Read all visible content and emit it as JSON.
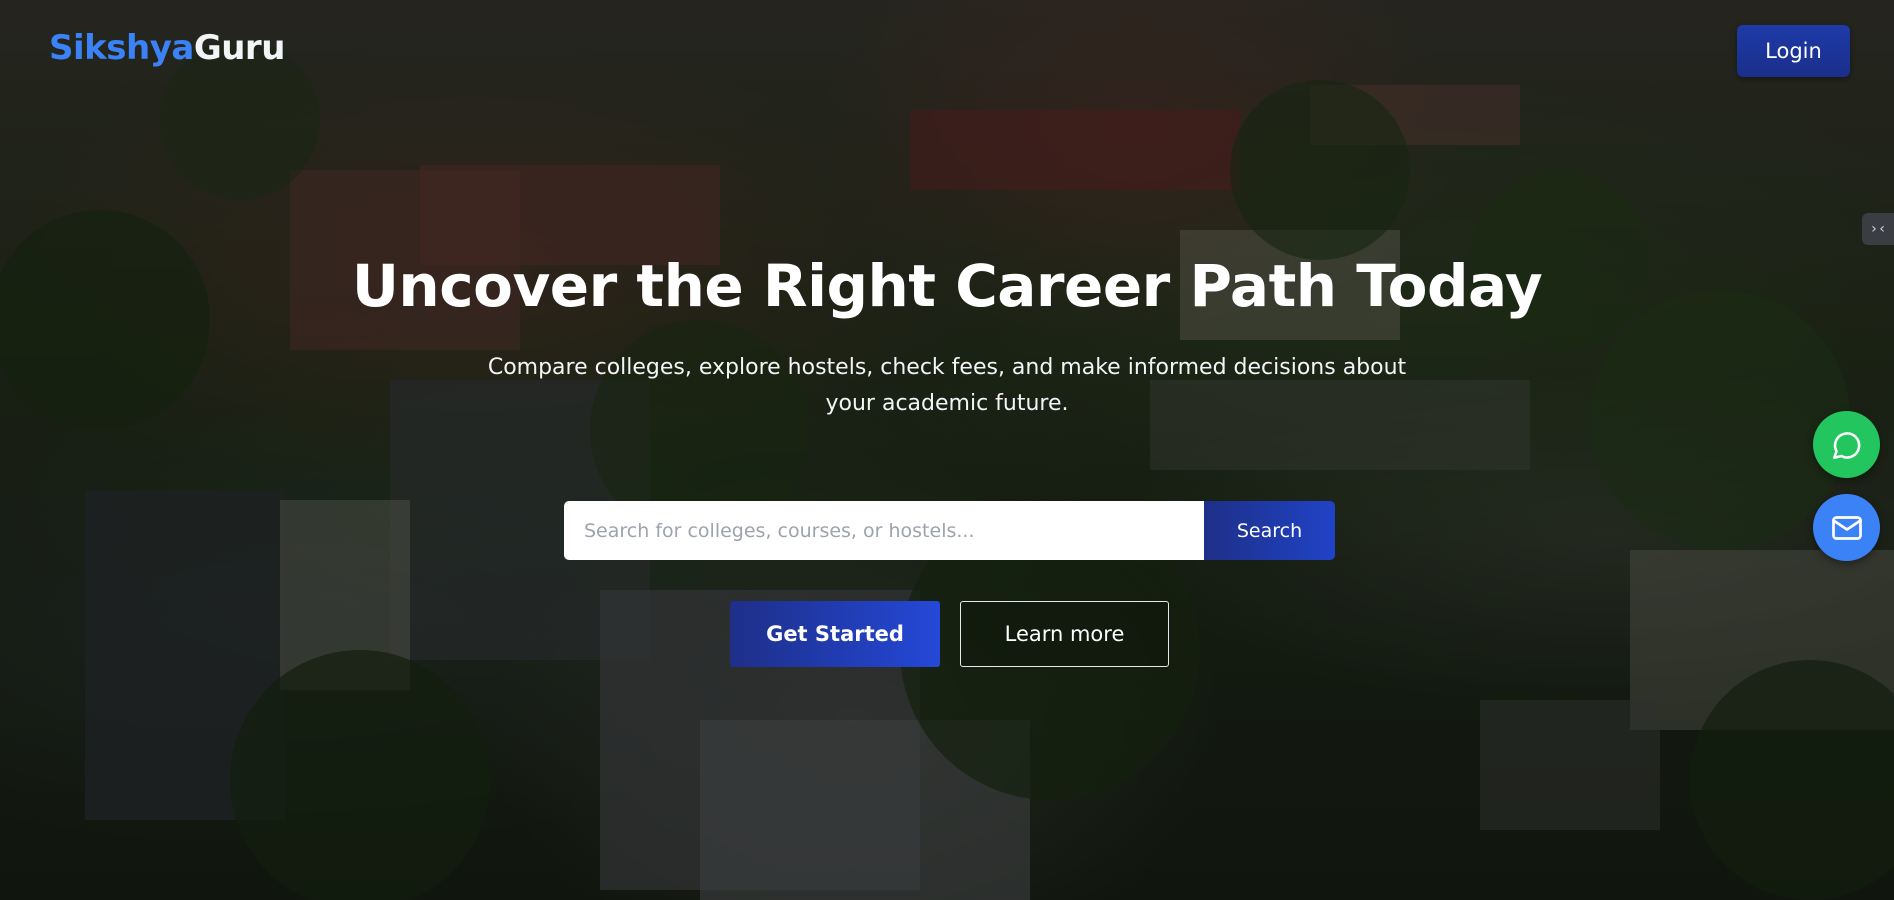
{
  "header": {
    "logo_part1": "Sikshya",
    "logo_part2": "Guru",
    "login_label": "Login"
  },
  "hero": {
    "title": "Uncover the Right Career Path Today",
    "subtitle_line1": "Compare colleges, explore hostels, check fees, and make informed decisions about",
    "subtitle_line2": "your academic future.",
    "search": {
      "placeholder": "Search for colleges, courses, or hostels...",
      "value": "",
      "button_label": "Search"
    },
    "cta": {
      "primary_label": "Get Started",
      "secondary_label": "Learn more"
    }
  },
  "floating": {
    "side_tab_icon": "collapse-arrows-icon",
    "side_tab_glyph": "›‹",
    "whatsapp_icon": "whatsapp-icon",
    "mail_icon": "mail-icon"
  },
  "colors": {
    "brand_blue": "#3b82f6",
    "button_navy": "#1e2f88",
    "whatsapp_green": "#22c55e"
  }
}
